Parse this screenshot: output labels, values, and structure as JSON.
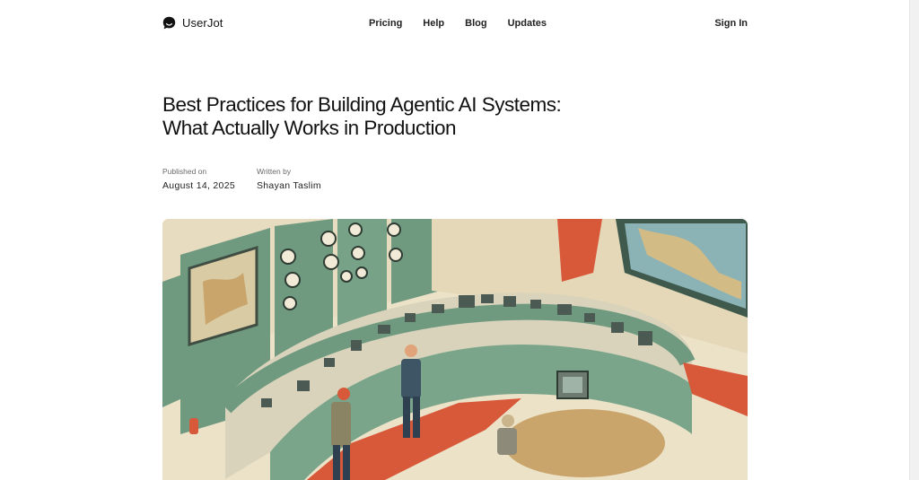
{
  "brand": {
    "name": "UserJot",
    "icon": "chat-bubble-icon"
  },
  "nav": {
    "items": [
      {
        "label": "Pricing"
      },
      {
        "label": "Help"
      },
      {
        "label": "Blog"
      },
      {
        "label": "Updates"
      }
    ],
    "sign_in": "Sign In"
  },
  "article": {
    "title": "Best Practices for Building Agentic AI Systems: What Actually Works in Production",
    "published_label": "Published on",
    "published_date": "August 14, 2025",
    "author_label": "Written by",
    "author": "Shayan Taslim",
    "hero_image": "illustration-control-room"
  },
  "colors": {
    "panel_green": "#6f9a80",
    "accent_red": "#d8583a",
    "floor_cream": "#ece2c8",
    "text": "#111111"
  }
}
